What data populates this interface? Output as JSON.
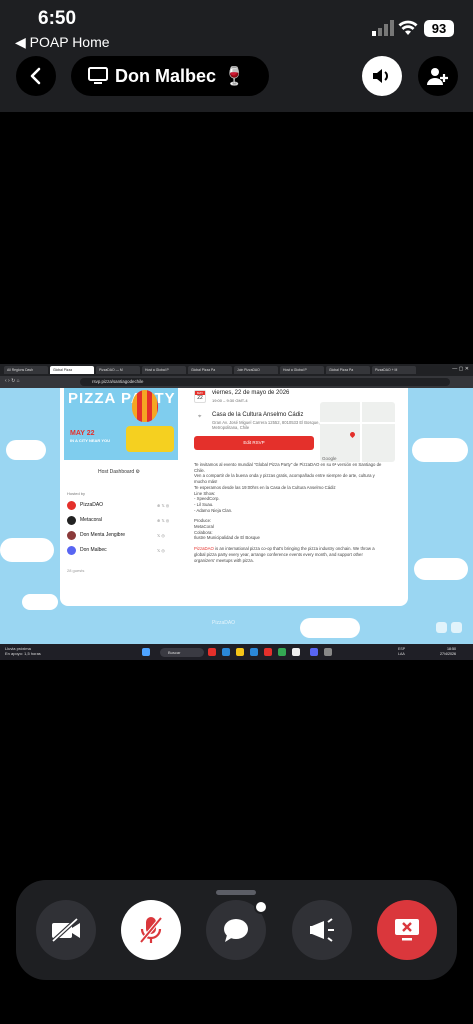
{
  "status": {
    "time": "6:50",
    "back_label": "◀ POAP Home",
    "battery": "93"
  },
  "header": {
    "channel_name": "Don Malbec",
    "channel_emoji": "🍷"
  },
  "browser": {
    "tabs": [
      "All Regions Dash",
      "Global Pizza",
      "PizzaDAO — M",
      "Host a Global P",
      "Global Pizza Pa",
      "Join PizzaDAO",
      "Host a Global P",
      "Global Pizza Pa",
      "PizzaDAO + M"
    ],
    "url": "rsvp.pizza/santiagodechile"
  },
  "event": {
    "hero_title": "PIZZA PARTY",
    "hero_date": "MAY 22",
    "hero_sub": "IN A CITY NEAR YOU",
    "host_dashboard": "Host Dashboard",
    "hosted_by": "Hosted by",
    "hosts": [
      {
        "name": "PizzaDAO",
        "color": "#e4302b",
        "social": "⊕ 𝕏 ◎"
      },
      {
        "name": "Metacoral",
        "color": "#222222",
        "social": "⊕ 𝕏 ◎"
      },
      {
        "name": "Don Menta Jengibre",
        "color": "#8b3a3a",
        "social": "𝕏 ◎"
      },
      {
        "name": "Don Malbec",
        "color": "#5865f2",
        "social": "𝕏 ◎"
      }
    ],
    "guests": "28 guests",
    "cal_month": "MAY",
    "cal_day": "22",
    "date": "viernes, 22 de mayo de 2026",
    "time": "19:00 – 9:30 GMT-4",
    "venue": "Casa de la Cultura Anselmo Cádiz",
    "address": "Gran Av. José Miguel Carrera 12552, 8010533 El Bosque, Región Metropolitana, Chile",
    "rsvp_label": "Edit RSVP",
    "map_label": "Google",
    "description": [
      "Te invitamos al evento mundial \"Global Pizza Party\" de PizzaDAO en su 6ª versión en Santiago de",
      "Chile.",
      "Ven a compartir de la buena onda y pizzas gratis, acompañado entre siempre de arte, cultura y",
      "mucho más!",
      "Te esperamos desde las 19:00hrs en la Casa de la Cultura Anselmo Cádiz",
      "Line Show:",
      "- XpeedCorp.",
      "- Lil Suau.",
      "- Adamo Nieja Clan.",
      "",
      "Produce:",
      "MetaCoral",
      "Colabora:",
      "Ilustre Municipalidad de El Bosque"
    ],
    "pizzadao_link": "PizzaDAO",
    "pizzadao_text": " is an international pizza co-op that's bringing the pizza industry onchain. We throw a",
    "pizzadao_text2": "global pizza party every year, arrange conference events every month, and support other",
    "pizzadao_text3": "organizers' meetups with pizza.",
    "footer": "PizzaDAO"
  },
  "taskbar": {
    "weather": "Lluvia próxima",
    "weather2": "En apoyo: 1,5 horas",
    "search": "Buscar",
    "lang": "ESP LAA",
    "clock": "18:50",
    "date": "27/4/2026"
  }
}
